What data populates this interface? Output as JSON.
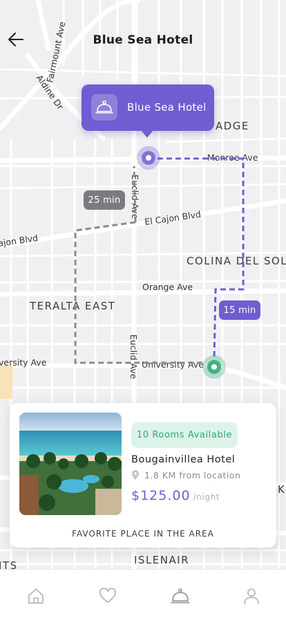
{
  "header": {
    "title": "Blue Sea Hotel"
  },
  "map": {
    "streets": {
      "fairmount": "Fairmount Ave",
      "aldine": "Aldine Dr",
      "monroe": "Monroe Ave",
      "euclid_top": "Euclid Ave",
      "el_cajon_right": "El Cajon Blvd",
      "el_cajon_left": "ajon Blvd",
      "orange": "Orange Ave",
      "university_left": "versity Ave",
      "university_right": "University Ave",
      "euclid_bottom": "Euclid Ave"
    },
    "areas": {
      "ridge": "ADGE",
      "colina": "COLINA DEL SOL",
      "teralta": "TERALTA EAST",
      "islenair": "ISLENAIR",
      "edge_left": "ITS",
      "edge_right": "K"
    }
  },
  "pin": {
    "label": "Blue Sea Hotel",
    "icon": "cloche-icon"
  },
  "routes": {
    "walking_time": "25 min",
    "driving_time": "15 min"
  },
  "hotel_card": {
    "rooms_available": "10 Rooms Available",
    "name": "Bougainvillea Hotel",
    "distance": "1.8 KM from location",
    "price": "$125.00",
    "price_unit": "/night",
    "caption": "FAVORITE PLACE IN THE AREA"
  },
  "nav": {
    "items": [
      {
        "name": "home",
        "icon": "home-icon"
      },
      {
        "name": "favorites",
        "icon": "heart-icon"
      },
      {
        "name": "hotels",
        "icon": "cloche-icon",
        "active": true
      },
      {
        "name": "profile",
        "icon": "user-icon"
      }
    ]
  },
  "colors": {
    "accent": "#6e5ed1",
    "success": "#2fa877",
    "route_grey": "#8a8a8e"
  }
}
